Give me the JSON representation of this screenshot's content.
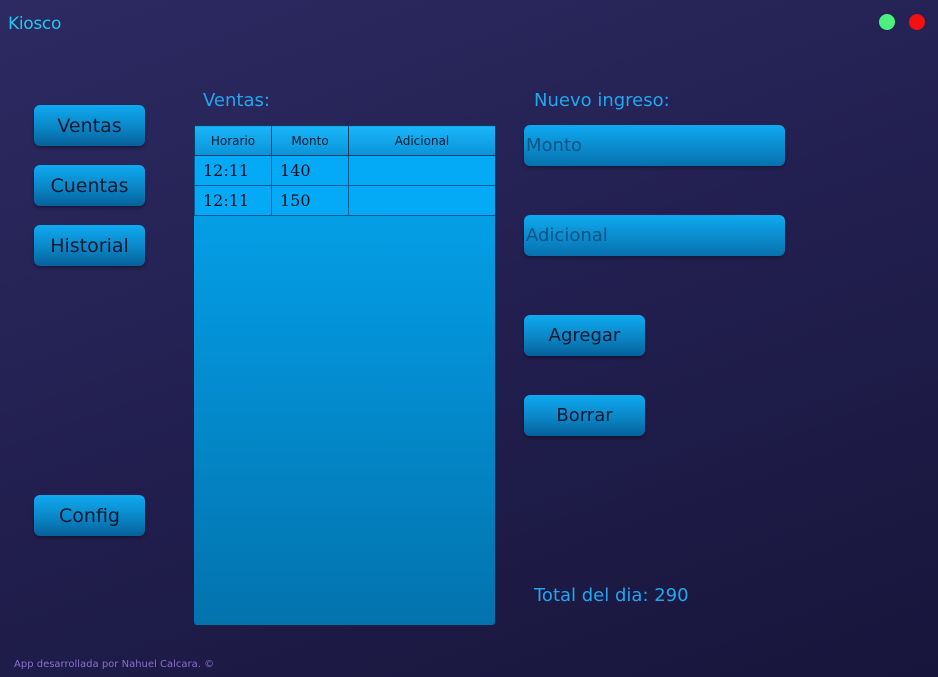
{
  "app": {
    "title": "Kiosco"
  },
  "window_controls": {
    "maximize_color": "#4cf07e",
    "close_color": "#f21010"
  },
  "nav": {
    "ventas": "Ventas",
    "cuentas": "Cuentas",
    "historial": "Historial",
    "config": "Config"
  },
  "sales": {
    "title": "Ventas:",
    "columns": [
      "Horario",
      "Monto",
      "Adicional"
    ],
    "rows": [
      {
        "horario": "12:11",
        "monto": "140",
        "adicional": ""
      },
      {
        "horario": "12:11",
        "monto": "150",
        "adicional": ""
      }
    ]
  },
  "new_entry": {
    "title": "Nuevo ingreso:",
    "monto_placeholder": "Monto",
    "adicional_placeholder": "Adicional",
    "add_label": "Agregar",
    "clear_label": "Borrar"
  },
  "total": {
    "label": "Total del dia: 290"
  },
  "footer": {
    "text": "App desarrollada por Nahuel Calcara. ©"
  },
  "colors": {
    "accent": "#22a6f0",
    "title": "#22c6ee",
    "button": "#0a86c6",
    "footer": "#8a6ed0"
  }
}
